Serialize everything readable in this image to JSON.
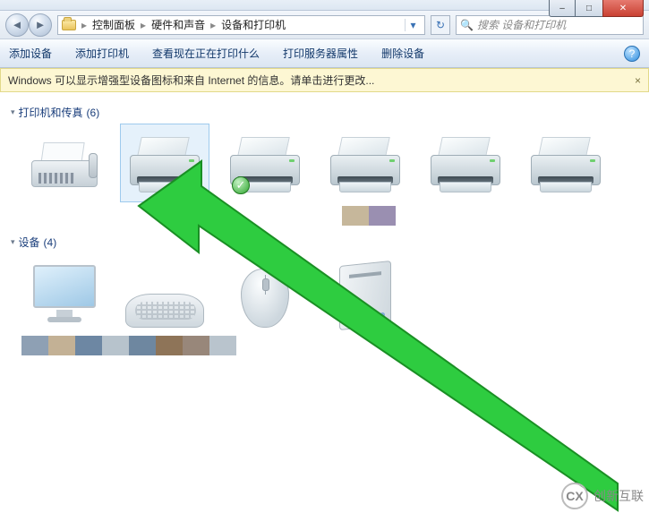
{
  "window": {
    "min_symbol": "–",
    "max_symbol": "□",
    "close_symbol": "✕"
  },
  "nav": {
    "back_symbol": "◄",
    "fwd_symbol": "►",
    "crumb1": "控制面板",
    "crumb2": "硬件和声音",
    "crumb3": "设备和打印机",
    "sep": "▸",
    "dropdown_symbol": "▾",
    "refresh_symbol": "↻"
  },
  "search": {
    "icon": "🔍",
    "placeholder": "搜索 设备和打印机"
  },
  "toolbar": {
    "add_device": "添加设备",
    "add_printer": "添加打印机",
    "view_queue": "查看现在正在打印什么",
    "server_props": "打印服务器属性",
    "remove_device": "删除设备",
    "help_symbol": "?"
  },
  "infobar": {
    "text": "Windows 可以显示增强型设备图标和来自 Internet 的信息。请单击进行更改...",
    "close_symbol": "×"
  },
  "groups": {
    "printers": {
      "label": "打印机和传真",
      "count": "(6)"
    },
    "devices": {
      "label": "设备",
      "count": "(4)"
    }
  },
  "swatches_row1": [
    "#c6b79b",
    "#9a8fb1"
  ],
  "swatches_row2": [
    "#8ea0b4",
    "#c3b195",
    "#6d87a3",
    "#b7c3cc",
    "#6e87a0",
    "#8e7458",
    "#98877a",
    "#b9c4cd"
  ],
  "watermark": {
    "logo": "CX",
    "text": "创新互联"
  },
  "annotation": {
    "check_symbol": "✓"
  }
}
